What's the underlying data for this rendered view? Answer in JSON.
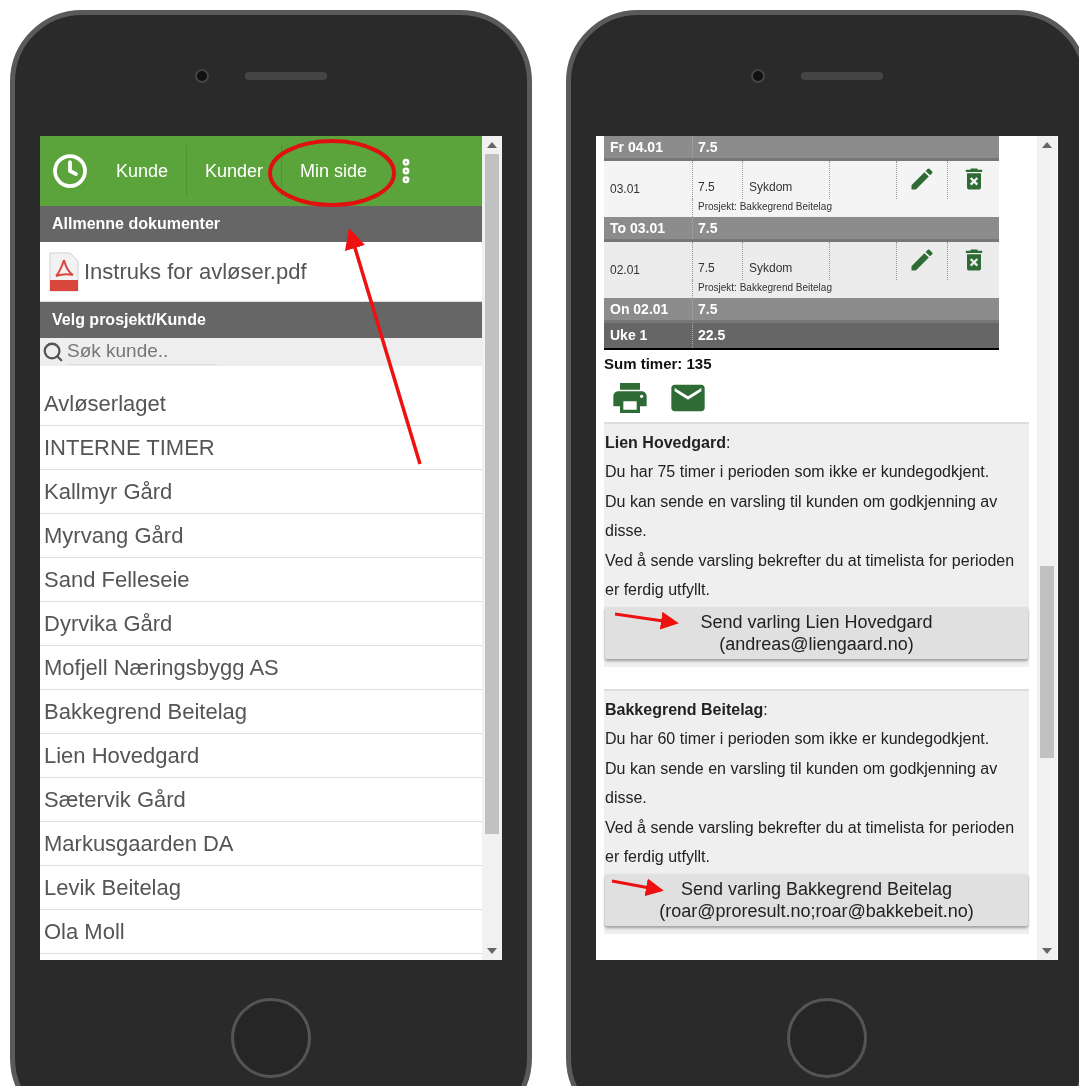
{
  "left_screen": {
    "app_bar": {
      "tabs": [
        {
          "label": "Kunde"
        },
        {
          "label": "Kunder"
        },
        {
          "label": "Min side"
        }
      ]
    },
    "documents_section": {
      "title": "Allmenne dokumenter",
      "files": [
        "Instruks for avløser.pdf"
      ]
    },
    "customer_section": {
      "title": "Velg prosjekt/Kunde",
      "search": {
        "placeholder": "Søk kunde.."
      },
      "customers": [
        "Avløserlaget",
        "INTERNE TIMER",
        "Kallmyr Gård",
        "Myrvang Gård",
        "Sand Felleseie",
        "Dyrvika Gård",
        "Mofjell Næringsbygg AS",
        "Bakkegrend Beitelag",
        "Lien Hovedgard",
        "Sætervik Gård",
        "Markusgaarden DA",
        "Levik Beitelag",
        "Ola Moll"
      ]
    }
  },
  "right_screen": {
    "timesheet": {
      "rows": [
        {
          "kind": "day_total",
          "label": "Fr 04.01",
          "hours": "7.5"
        },
        {
          "kind": "entry",
          "date": "03.01",
          "hours": "7.5",
          "type": "Sykdom",
          "project": "Prosjekt: Bakkegrend Beitelag"
        },
        {
          "kind": "day_total",
          "label": "To 03.01",
          "hours": "7.5"
        },
        {
          "kind": "entry",
          "date": "02.01",
          "hours": "7.5",
          "type": "Sykdom",
          "project": "Prosjekt: Bakkegrend Beitelag"
        },
        {
          "kind": "day_total",
          "label": "On 02.01",
          "hours": "7.5"
        },
        {
          "kind": "week_total",
          "label": "Uke 1",
          "hours": "22.5"
        }
      ]
    },
    "sum": "Sum timer: 135",
    "notices": [
      {
        "heading": "**Lien Hovedgard**:",
        "lines": [
          "Du har 75 timer i perioden som ikke er kundegodkjent.",
          "Du kan sende en varsling til kunden om godkjenning av disse.",
          "Ved å sende varsling bekrefter du at timelista for perioden er ferdig utfyllt."
        ],
        "button": {
          "label": "Send varling Lien Hovedgard",
          "email": "(andreas@liengaard.no)"
        }
      },
      {
        "heading": "**Bakkegrend Beitelag**:",
        "lines": [
          "Du har 60 timer i perioden som ikke er kundegodkjent.",
          "Du kan sende en varsling til kunden om godkjenning av disse.",
          "Ved å sende varsling bekrefter du at timelista for perioden er ferdig utfyllt."
        ],
        "button": {
          "label": "Send varling Bakkegrend Beitelag",
          "email": "(roar@proresult.no;roar@bakkebeit.no)"
        }
      }
    ]
  }
}
